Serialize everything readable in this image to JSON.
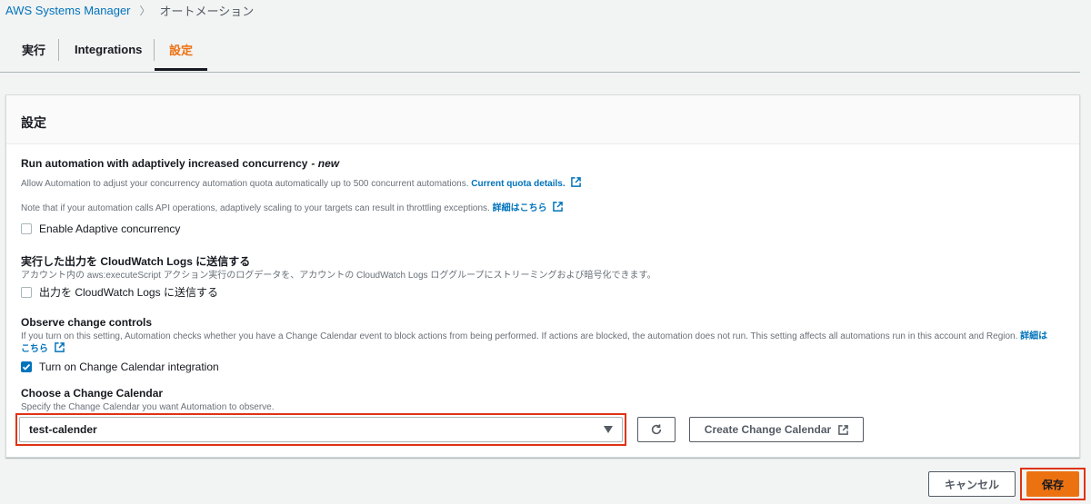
{
  "breadcrumb": {
    "root": "AWS Systems Manager",
    "separator": "〉",
    "current": "オートメーション"
  },
  "tabs": [
    {
      "label": "実行"
    },
    {
      "label": "Integrations"
    },
    {
      "label": "設定",
      "active": true
    }
  ],
  "panel": {
    "title": "設定",
    "adaptive": {
      "label": "Run automation with adaptively increased concurrency",
      "badge": "- new",
      "desc1": "Allow Automation to adjust your concurrency automation quota automatically up to 500 concurrent automations.",
      "desc1_link": "Current quota details.",
      "desc2": "Note that if your automation calls API operations, adaptively scaling to your targets can result in throttling exceptions.",
      "desc2_link": "詳細はこちら",
      "checkbox_label": "Enable Adaptive concurrency",
      "checked": false
    },
    "cloudwatch": {
      "label": "実行した出力を CloudWatch Logs に送信する",
      "desc": "アカウント内の aws:executeScript アクション実行のログデータを、アカウントの CloudWatch Logs ロググループにストリーミングおよび暗号化できます。",
      "checkbox_label": "出力を CloudWatch Logs に送信する",
      "checked": false
    },
    "change_controls": {
      "label": "Observe change controls",
      "desc": "If you turn on this setting, Automation checks whether you have a Change Calendar event to block actions from being performed. If actions are blocked, the automation does not run. This setting affects all automations run in this account and Region.",
      "desc_link": "詳細はこちら",
      "checkbox_label": "Turn on Change Calendar integration",
      "checked": true
    },
    "calendar": {
      "label": "Choose a Change Calendar",
      "desc": "Specify the Change Calendar you want Automation to observe.",
      "selected": "test-calender",
      "create_label": "Create Change Calendar"
    }
  },
  "footer": {
    "cancel_label": "キャンセル",
    "save_label": "保存"
  },
  "colors": {
    "accent": "#ec7211",
    "link": "#0073bb",
    "highlight": "#df3312"
  }
}
